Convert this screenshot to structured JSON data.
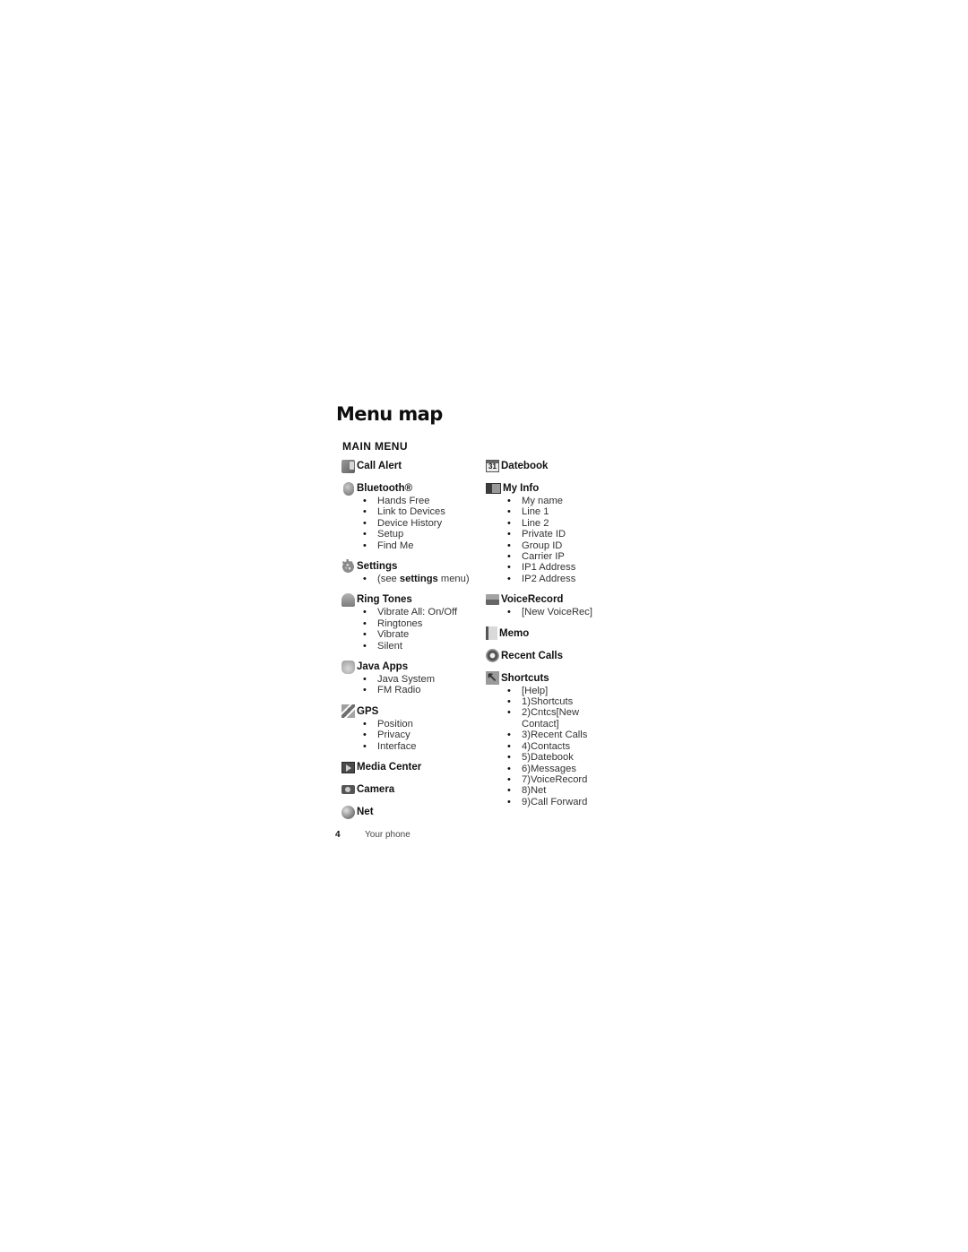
{
  "page": {
    "title": "Menu map",
    "section_heading": "MAIN MENU",
    "footer": {
      "page_number": "4",
      "label": "Your phone"
    }
  },
  "left_column": [
    {
      "icon": "call-alert-icon",
      "label": "Call Alert",
      "items": []
    },
    {
      "icon": "bluetooth-icon",
      "label": "Bluetooth®",
      "items": [
        "Hands Free",
        "Link to Devices",
        "Device History",
        "Setup",
        "Find Me"
      ]
    },
    {
      "icon": "settings-gear-icon",
      "label": "Settings",
      "items": [],
      "note": {
        "prefix": "(see ",
        "bold": "settings",
        "suffix": " menu)"
      }
    },
    {
      "icon": "ring-tones-bell-icon",
      "label": "Ring Tones",
      "items": [
        "Vibrate All: On/Off",
        "Ringtones",
        "Vibrate",
        "Silent"
      ]
    },
    {
      "icon": "java-apps-icon",
      "label": "Java Apps",
      "items": [
        "Java System",
        "FM Radio"
      ]
    },
    {
      "icon": "gps-satellite-icon",
      "label": "GPS",
      "items": [
        "Position",
        "Privacy",
        "Interface"
      ]
    },
    {
      "icon": "media-center-icon",
      "label": "Media Center",
      "items": []
    },
    {
      "icon": "camera-icon",
      "label": "Camera",
      "items": []
    },
    {
      "icon": "net-globe-icon",
      "label": "Net",
      "items": []
    }
  ],
  "right_column": [
    {
      "icon": "datebook-calendar-icon",
      "icon_text": "31",
      "label": "Datebook",
      "items": []
    },
    {
      "icon": "my-info-icon",
      "label": "My Info",
      "items": [
        "My name",
        "Line 1",
        "Line 2",
        "Private ID",
        "Group ID",
        "Carrier IP",
        "IP1 Address",
        "IP2 Address"
      ]
    },
    {
      "icon": "voice-record-icon",
      "label": "VoiceRecord",
      "items": [
        "[New VoiceRec]"
      ]
    },
    {
      "icon": "memo-notepad-icon",
      "label": "Memo",
      "items": []
    },
    {
      "icon": "recent-calls-icon",
      "label": "Recent Calls",
      "items": []
    },
    {
      "icon": "shortcuts-arrow-icon",
      "label": "Shortcuts",
      "items": [
        "[Help]",
        "1)Shortcuts",
        "2)Cntcs[New Contact]",
        "3)Recent Calls",
        "4)Contacts",
        "5)Datebook",
        "6)Messages",
        "7)VoiceRecord",
        "8)Net",
        "9)Call Forward"
      ]
    }
  ]
}
